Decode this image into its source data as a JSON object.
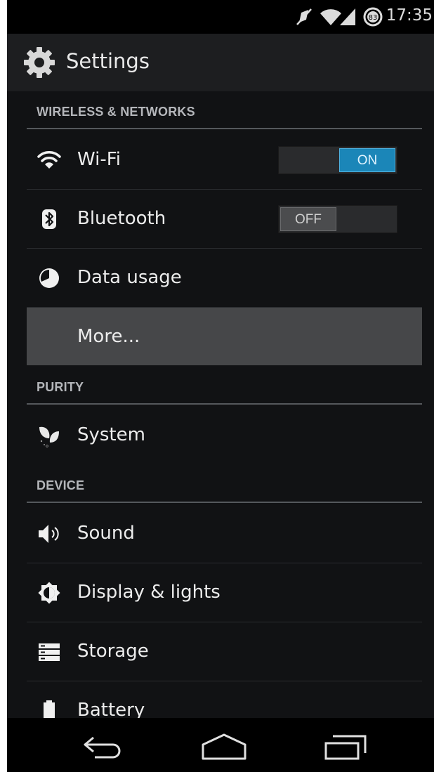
{
  "status_bar": {
    "time": "17:35",
    "battery_level": "83",
    "icons": [
      "muted-icon",
      "wifi-signal-icon",
      "cell-signal-icon",
      "battery-icon"
    ]
  },
  "action_bar": {
    "title": "Settings",
    "icon": "settings-gear-icon"
  },
  "sections": {
    "wireless": {
      "header": "WIRELESS & NETWORKS",
      "items": [
        {
          "label": "Wi-Fi",
          "icon": "wifi-icon",
          "toggle": "ON"
        },
        {
          "label": "Bluetooth",
          "icon": "bluetooth-icon",
          "toggle": "OFF"
        },
        {
          "label": "Data usage",
          "icon": "data-usage-icon"
        },
        {
          "label": "More..."
        }
      ]
    },
    "purity": {
      "header": "PURITY",
      "items": [
        {
          "label": "System",
          "icon": "leaf-icon"
        }
      ]
    },
    "device": {
      "header": "DEVICE",
      "items": [
        {
          "label": "Sound",
          "icon": "speaker-icon"
        },
        {
          "label": "Display & lights",
          "icon": "brightness-icon"
        },
        {
          "label": "Storage",
          "icon": "storage-icon"
        },
        {
          "label": "Battery",
          "icon": "battery-icon"
        }
      ]
    }
  },
  "nav_bar": {
    "buttons": [
      "back",
      "home",
      "recents"
    ]
  },
  "colors": {
    "accent": "#1b86b8",
    "background": "#111214",
    "action_bar": "#1d1e20",
    "selected_row": "#464749"
  }
}
